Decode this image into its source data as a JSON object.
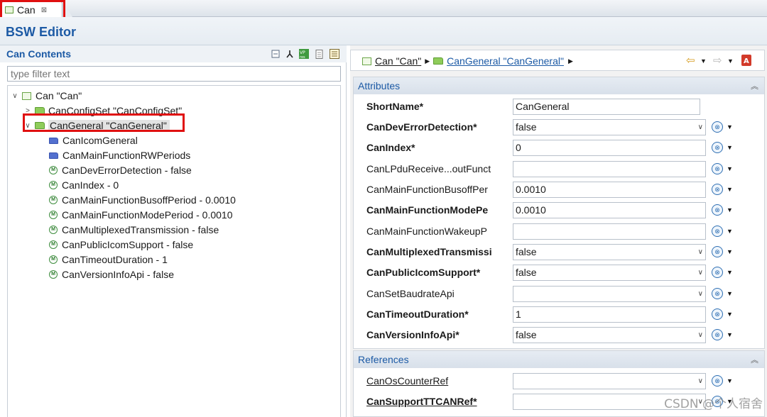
{
  "tab": {
    "label": "Can",
    "close": "⊠"
  },
  "editor": {
    "title": "BSW Editor"
  },
  "left": {
    "title": "Can Contents",
    "filter_placeholder": "type filter text",
    "tree": [
      {
        "label": "Can \"Can\"",
        "level": 0,
        "twisty": "∨",
        "icon": "root-config-icon"
      },
      {
        "label": "CanConfigSet \"CanConfigSet\"",
        "level": 1,
        "twisty": ">",
        "icon": "folder-icon"
      },
      {
        "label": "CanGeneral \"CanGeneral\"",
        "level": 1,
        "twisty": "∨",
        "icon": "folder-icon",
        "selected": true
      },
      {
        "label": "CanIcomGeneral",
        "level": 2,
        "icon": "container-icon"
      },
      {
        "label": "CanMainFunctionRWPeriods",
        "level": 2,
        "icon": "container-icon"
      },
      {
        "label": "CanDevErrorDetection - false",
        "level": 2,
        "icon": "parameter-icon"
      },
      {
        "label": "CanIndex - 0",
        "level": 2,
        "icon": "parameter-icon"
      },
      {
        "label": "CanMainFunctionBusoffPeriod - 0.0010",
        "level": 2,
        "icon": "parameter-icon"
      },
      {
        "label": "CanMainFunctionModePeriod - 0.0010",
        "level": 2,
        "icon": "parameter-icon"
      },
      {
        "label": "CanMultiplexedTransmission - false",
        "level": 2,
        "icon": "parameter-icon"
      },
      {
        "label": "CanPublicIcomSupport - false",
        "level": 2,
        "icon": "parameter-icon"
      },
      {
        "label": "CanTimeoutDuration - 1",
        "level": 2,
        "icon": "parameter-icon"
      },
      {
        "label": "CanVersionInfoApi - false",
        "level": 2,
        "icon": "parameter-icon"
      }
    ]
  },
  "breadcrumb": {
    "root": "Can \"Can\"",
    "current": "CanGeneral \"CanGeneral\""
  },
  "attributes": {
    "title": "Attributes",
    "rows": [
      {
        "label": "ShortName*",
        "bold": true,
        "type": "short",
        "value": "CanGeneral",
        "ctl": false
      },
      {
        "label": "CanDevErrorDetection*",
        "bold": true,
        "type": "combo",
        "value": "false",
        "ctl": true
      },
      {
        "label": "CanIndex*",
        "bold": true,
        "type": "text",
        "value": "0",
        "ctl": true
      },
      {
        "label": "CanLPduReceive...outFunct",
        "bold": false,
        "type": "text",
        "value": "",
        "ctl": true
      },
      {
        "label": "CanMainFunctionBusoffPer",
        "bold": false,
        "type": "text",
        "value": "0.0010",
        "ctl": true
      },
      {
        "label": "CanMainFunctionModePe",
        "bold": true,
        "type": "text",
        "value": "0.0010",
        "ctl": true
      },
      {
        "label": "CanMainFunctionWakeupP",
        "bold": false,
        "type": "text",
        "value": "",
        "ctl": true
      },
      {
        "label": "CanMultiplexedTransmissi",
        "bold": true,
        "type": "combo",
        "value": "false",
        "ctl": true
      },
      {
        "label": "CanPublicIcomSupport*",
        "bold": true,
        "type": "combo",
        "value": "false",
        "ctl": true
      },
      {
        "label": "CanSetBaudrateApi",
        "bold": false,
        "type": "combo",
        "value": "",
        "ctl": true
      },
      {
        "label": "CanTimeoutDuration*",
        "bold": true,
        "type": "text",
        "value": "1",
        "ctl": true
      },
      {
        "label": "CanVersionInfoApi*",
        "bold": true,
        "type": "combo",
        "value": "false",
        "ctl": true
      }
    ]
  },
  "references": {
    "title": "References",
    "rows": [
      {
        "label": "CanOsCounterRef",
        "bold": false,
        "type": "combo",
        "value": "",
        "ctl": true
      },
      {
        "label": "CanSupportTTCANRef*",
        "bold": true,
        "type": "combo",
        "value": "",
        "ctl": true
      }
    ]
  },
  "watermark": "CSDN @个人宿舍",
  "highlight_color": "#e01010"
}
